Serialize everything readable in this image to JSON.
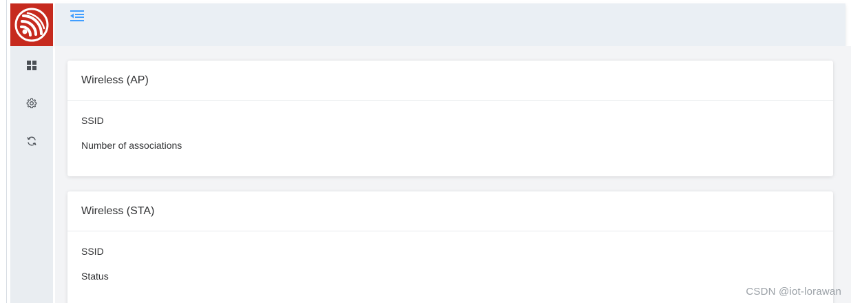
{
  "sidebar": {
    "logo_icon": "espressif-logo-icon",
    "brand_color": "#c62a1e",
    "items": [
      {
        "name": "dashboard",
        "icon": "grid-icon"
      },
      {
        "name": "settings",
        "icon": "gear-icon"
      },
      {
        "name": "update",
        "icon": "refresh-icon"
      }
    ]
  },
  "topbar": {
    "toggle_icon": "menu-fold-icon",
    "accent_color": "#409eff"
  },
  "cards": [
    {
      "title": "Wireless (AP)",
      "fields": [
        "SSID",
        "Number of associations"
      ]
    },
    {
      "title": "Wireless (STA)",
      "fields": [
        "SSID",
        "Status"
      ]
    }
  ],
  "watermark": "CSDN @iot-lorawan"
}
